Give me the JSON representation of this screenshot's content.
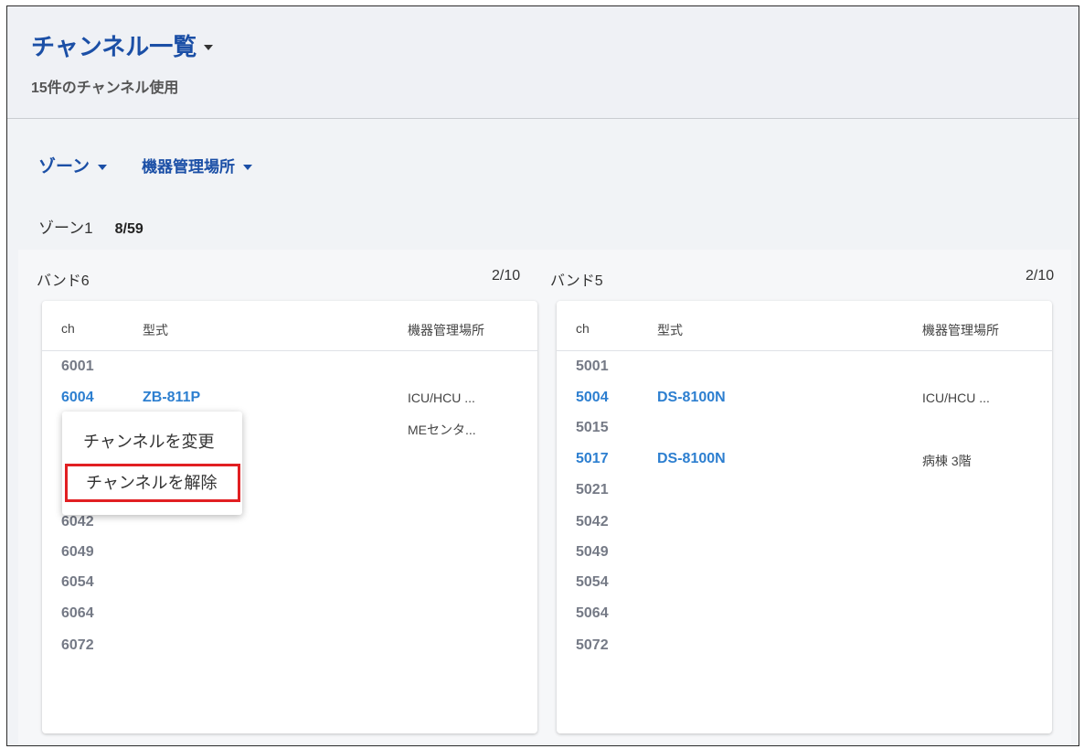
{
  "header": {
    "title": "チャンネル一覧",
    "subtitle": "15件のチャンネル使用"
  },
  "filters": {
    "zone_label": "ゾーン",
    "place_label": "機器管理場所"
  },
  "zone": {
    "name": "ゾーン1",
    "count": "8/59"
  },
  "columns": {
    "ch": "ch",
    "model": "型式",
    "place": "機器管理場所"
  },
  "bands": [
    {
      "name": "バンド6",
      "count": "2/10",
      "rows": [
        {
          "ch": "6001",
          "model": "",
          "place": ""
        },
        {
          "ch": "6004",
          "model": "ZB-811P",
          "place": "ICU/HCU ..."
        },
        {
          "ch": "",
          "model": "",
          "place": "MEセンタ..."
        },
        {
          "ch": "6042",
          "model": "",
          "place": ""
        },
        {
          "ch": "6049",
          "model": "",
          "place": ""
        },
        {
          "ch": "6054",
          "model": "",
          "place": ""
        },
        {
          "ch": "6064",
          "model": "",
          "place": ""
        },
        {
          "ch": "6072",
          "model": "",
          "place": ""
        }
      ]
    },
    {
      "name": "バンド5",
      "count": "2/10",
      "rows": [
        {
          "ch": "5001",
          "model": "",
          "place": ""
        },
        {
          "ch": "5004",
          "model": "DS-8100N",
          "place": "ICU/HCU ..."
        },
        {
          "ch": "5015",
          "model": "",
          "place": ""
        },
        {
          "ch": "5017",
          "model": "DS-8100N",
          "place": "病棟 3階"
        },
        {
          "ch": "5021",
          "model": "",
          "place": ""
        },
        {
          "ch": "5042",
          "model": "",
          "place": ""
        },
        {
          "ch": "5049",
          "model": "",
          "place": ""
        },
        {
          "ch": "5054",
          "model": "",
          "place": ""
        },
        {
          "ch": "5064",
          "model": "",
          "place": ""
        },
        {
          "ch": "5072",
          "model": "",
          "place": ""
        }
      ]
    }
  ],
  "context_menu": {
    "change_label": "チャンネルを変更",
    "release_label": "チャンネルを解除"
  },
  "colors": {
    "accent": "#1b4fa6",
    "link": "#2d7fd0",
    "highlight": "#e11f22"
  }
}
